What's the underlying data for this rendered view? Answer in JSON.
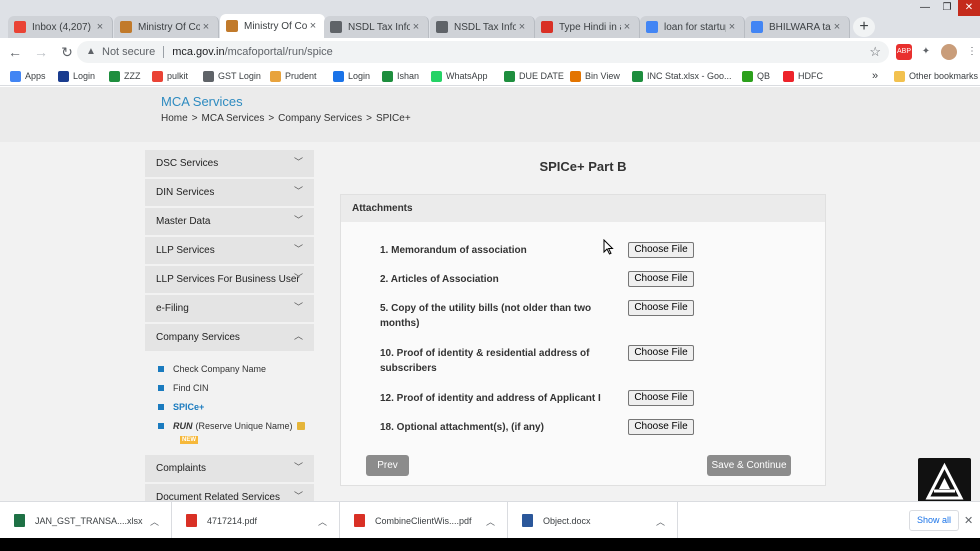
{
  "browser": {
    "tabs": [
      {
        "title": "Inbox (4,207) -",
        "icon": "gmail-icon",
        "color": "#ea4335",
        "active": false
      },
      {
        "title": "Ministry Of Cor",
        "icon": "mca-emblem-icon",
        "color": "#c17a2b",
        "active": false
      },
      {
        "title": "Ministry Of Cor",
        "icon": "mca-emblem-icon",
        "color": "#c17a2b",
        "active": true
      },
      {
        "title": "NSDL Tax Infor",
        "icon": "globe-icon",
        "color": "#5f6368",
        "active": false
      },
      {
        "title": "NSDL Tax Infor",
        "icon": "globe-icon",
        "color": "#5f6368",
        "active": false
      },
      {
        "title": "Type Hindi in a",
        "icon": "hindi-icon",
        "color": "#d93025",
        "active": false
      },
      {
        "title": "loan for startup",
        "icon": "google-icon",
        "color": "#4285f4",
        "active": false
      },
      {
        "title": "BHILWARA tax",
        "icon": "google-icon",
        "color": "#4285f4",
        "active": false
      }
    ],
    "tab_close_glyph": "×",
    "new_tab_glyph": "+",
    "window_controls": {
      "minimize": "—",
      "maximize": "❐",
      "close": "✕"
    },
    "nav": {
      "back": "←",
      "forward": "→",
      "reload": "↻"
    },
    "omnibox": {
      "security": "Not secure",
      "host": "mca.gov.in",
      "path": "/mcafoportal/run/spice"
    },
    "bookmarks": [
      {
        "label": "Apps",
        "icon": "apps-grid-icon",
        "color": "#4285f4"
      },
      {
        "label": "Login",
        "icon": "ni-icon",
        "color": "#1a3c8f"
      },
      {
        "label": "ZZZ",
        "icon": "plus-green-icon",
        "color": "#1e8e3e"
      },
      {
        "label": "pulkit",
        "icon": "gmail-icon",
        "color": "#ea4335"
      },
      {
        "label": "GST Login",
        "icon": "gst-icon",
        "color": "#5f6368"
      },
      {
        "label": "Prudent",
        "icon": "folder-icon",
        "color": "#e8a33d"
      },
      {
        "label": "Login",
        "icon": "ie-icon",
        "color": "#1a73e8"
      },
      {
        "label": "Ishan",
        "icon": "plus-green-icon",
        "color": "#1e8e3e"
      },
      {
        "label": "WhatsApp",
        "icon": "whatsapp-icon",
        "color": "#25d366"
      },
      {
        "label": "DUE DATE",
        "icon": "plus-green-icon",
        "color": "#1e8e3e"
      },
      {
        "label": "Bin View",
        "icon": "binview-icon",
        "color": "#e37400"
      },
      {
        "label": "INC Stat.xlsx - Goo...",
        "icon": "plus-green-icon",
        "color": "#1e8e3e"
      },
      {
        "label": "QB",
        "icon": "qb-icon",
        "color": "#2ca01c"
      },
      {
        "label": "HDFC",
        "icon": "hdfc-icon",
        "color": "#ed232a"
      }
    ],
    "bookmarks_more": "»",
    "other_bookmarks": "Other bookmarks"
  },
  "page": {
    "brand": "MCA Services",
    "breadcrumb": [
      "Home",
      ">",
      "MCA Services",
      ">",
      "Company Services",
      ">",
      "SPICe+"
    ],
    "sidebar": [
      {
        "label": "DSC Services",
        "expanded": false
      },
      {
        "label": "DIN Services",
        "expanded": false
      },
      {
        "label": "Master Data",
        "expanded": false
      },
      {
        "label": "LLP Services",
        "expanded": false
      },
      {
        "label": "LLP Services For Business User",
        "expanded": false
      },
      {
        "label": "e-Filing",
        "expanded": false
      },
      {
        "label": "Company Services",
        "expanded": true
      }
    ],
    "sub_items": [
      {
        "label": "Check Company Name"
      },
      {
        "label": "Find CIN"
      },
      {
        "label": "SPICe+",
        "active": true
      },
      {
        "run": "RUN",
        "label": "(Reserve Unique Name)",
        "new_badge": "NEW"
      }
    ],
    "sidebar_after": [
      {
        "label": "Complaints"
      },
      {
        "label": "Document Related Services"
      }
    ],
    "title": "SPICe+ Part B",
    "panel_title": "Attachments",
    "attachments": [
      {
        "label": "1. Memorandum of association",
        "button": "Choose File"
      },
      {
        "label": "2. Articles of Association",
        "button": "Choose File"
      },
      {
        "label": "5. Copy of the utility bills (not older than two months)",
        "button": "Choose File"
      },
      {
        "label": "10. Proof of identity & residential address of subscribers",
        "button": "Choose File"
      },
      {
        "label": "12. Proof of identity and address of Applicant I",
        "button": "Choose File"
      },
      {
        "label": "18. Optional attachment(s), (if any)",
        "button": "Choose File"
      }
    ],
    "prev_label": "Prev",
    "save_label": "Save & Continue"
  },
  "downloads": {
    "items": [
      {
        "name": "JAN_GST_TRANSA....xlsx",
        "icon": "excel-icon",
        "color": "#1e7145"
      },
      {
        "name": "4717214.pdf",
        "icon": "pdf-icon",
        "color": "#d93025"
      },
      {
        "name": "CombineClientWis....pdf",
        "icon": "pdf-icon",
        "color": "#d93025"
      },
      {
        "name": "Object.docx",
        "icon": "word-icon",
        "color": "#2b579a"
      }
    ],
    "show_all": "Show all",
    "close": "✕"
  }
}
